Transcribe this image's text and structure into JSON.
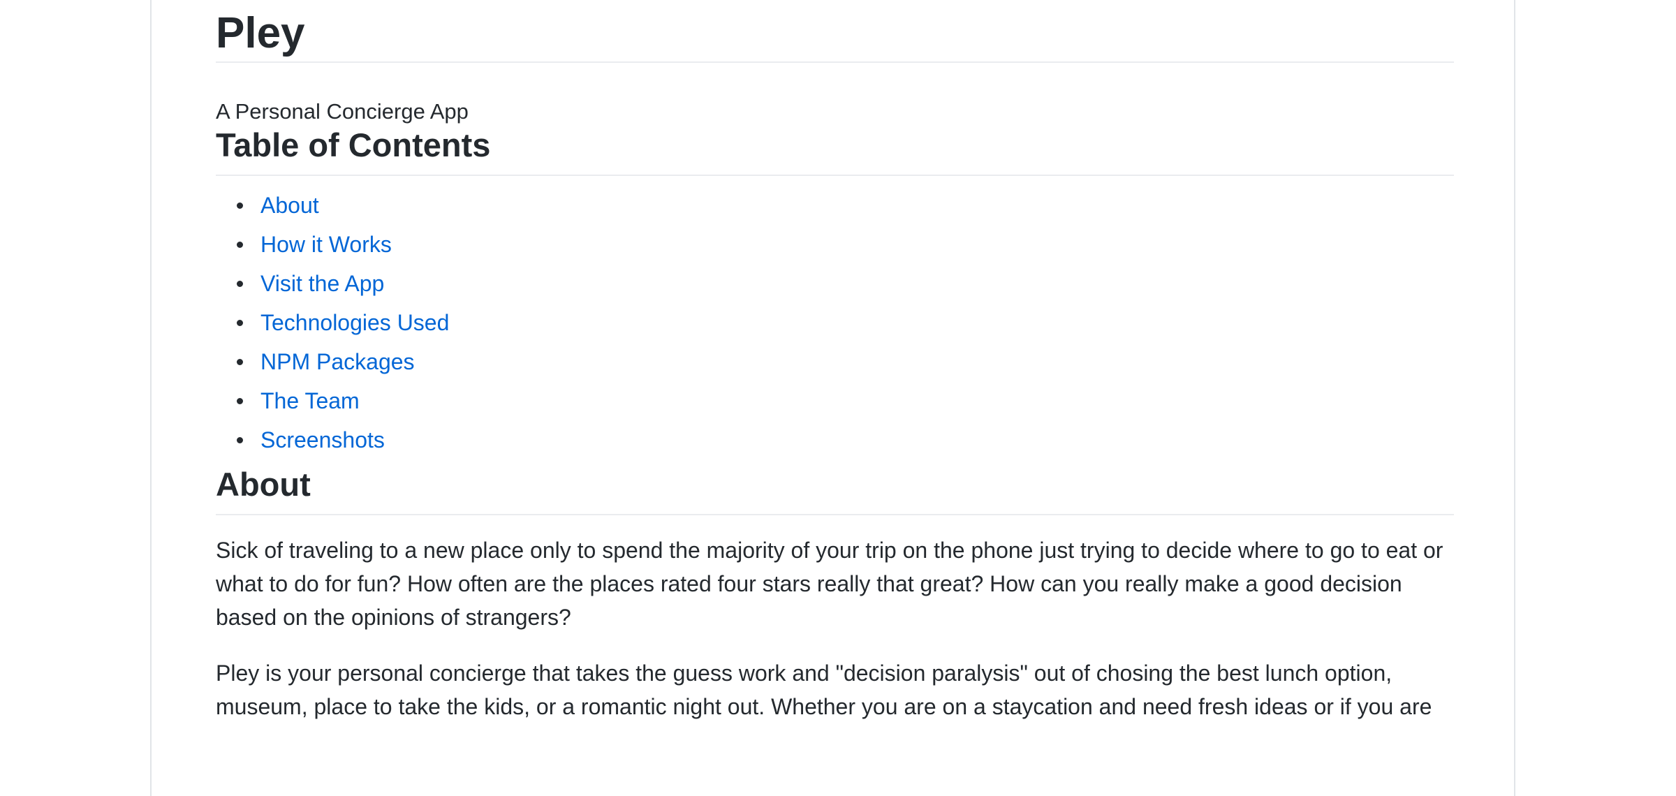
{
  "readme": {
    "title": "Pley",
    "tagline": "A Personal Concierge App",
    "toc_heading": "Table of Contents",
    "toc_items": [
      {
        "label": "About"
      },
      {
        "label": "How it Works"
      },
      {
        "label": "Visit the App"
      },
      {
        "label": "Technologies Used"
      },
      {
        "label": "NPM Packages"
      },
      {
        "label": "The Team"
      },
      {
        "label": "Screenshots"
      }
    ],
    "about_heading": "About",
    "paragraphs": [
      "Sick of traveling to a new place only to spend the majority of your trip on the phone just trying to decide where to go to eat or what to do for fun? How often are the places rated four stars really that great? How can you really make a good decision based on the opinions of strangers?",
      "Pley is your personal concierge that takes the guess work and \"decision paralysis\" out of chosing the best lunch option, museum, place to take the kids, or a romantic night out. Whether you are on a staycation and need fresh ideas or if you are"
    ]
  },
  "colors": {
    "link": "#0366d6",
    "text": "#24292e",
    "border": "#eaecef"
  }
}
